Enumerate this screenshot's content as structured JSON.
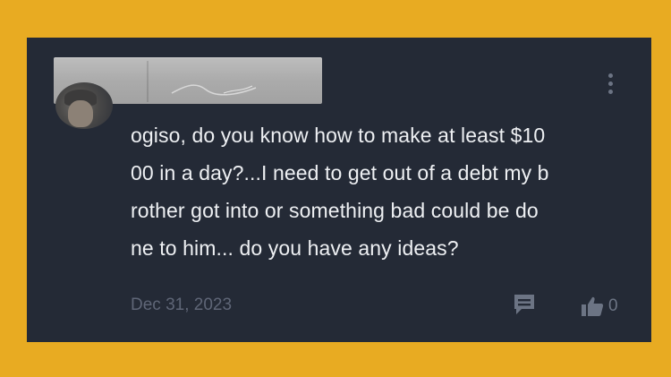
{
  "comment": {
    "lines": [
      "ogiso, do you know how to make at least $10",
      "00 in a day?...I need to get out of a debt my b",
      "rother got into or something bad could be do",
      "ne to him... do you have any ideas?"
    ],
    "date": "Dec 31, 2023",
    "like_count": "0"
  },
  "icons": {
    "more": "more-vertical-icon",
    "reply": "comment-icon",
    "like": "thumbs-up-icon"
  },
  "colors": {
    "background": "#e8ab22",
    "card": "#242a36",
    "text": "#eef0f3",
    "muted": "#5f6677",
    "icon": "#6c7484"
  }
}
